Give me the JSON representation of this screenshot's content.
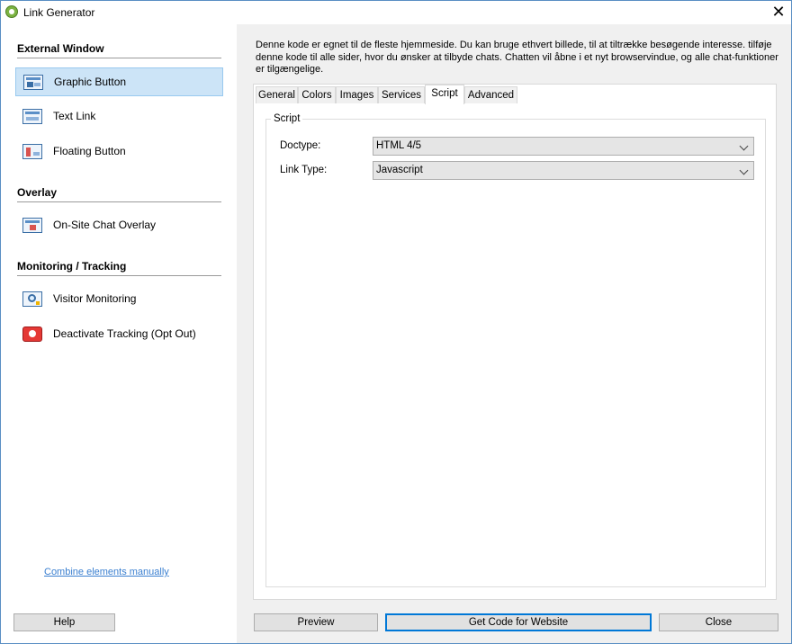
{
  "window": {
    "title": "Link Generator"
  },
  "sidebar": {
    "sections": [
      {
        "header": "External Window",
        "items": [
          {
            "label": "Graphic Button",
            "icon": "graphic-button-icon",
            "selected": true
          },
          {
            "label": "Text Link",
            "icon": "text-link-icon"
          },
          {
            "label": "Floating Button",
            "icon": "floating-button-icon"
          }
        ]
      },
      {
        "header": "Overlay",
        "items": [
          {
            "label": "On-Site Chat Overlay",
            "icon": "chat-overlay-icon"
          }
        ]
      },
      {
        "header": "Monitoring / Tracking",
        "items": [
          {
            "label": "Visitor Monitoring",
            "icon": "visitor-monitoring-icon"
          },
          {
            "label": "Deactivate Tracking (Opt Out)",
            "icon": "deactivate-tracking-icon"
          }
        ]
      }
    ],
    "combine_link": "Combine elements manually"
  },
  "main": {
    "description": "Denne kode er egnet til de fleste hjemmeside. Du kan bruge ethvert billede, til at tiltrække besøgende interesse. tilføje denne kode til alle sider, hvor du ønsker at tilbyde chats. Chatten vil åbne i et nyt browservindue, og alle chat-funktioner er tilgængelige.",
    "tabs": [
      {
        "label": "General"
      },
      {
        "label": "Colors"
      },
      {
        "label": "Images"
      },
      {
        "label": "Services"
      },
      {
        "label": "Script",
        "active": true
      },
      {
        "label": "Advanced"
      }
    ],
    "script_group": {
      "title": "Script",
      "doctype_label": "Doctype:",
      "doctype_value": "HTML 4/5",
      "linktype_label": "Link Type:",
      "linktype_value": "Javascript"
    }
  },
  "buttons": {
    "help": "Help",
    "preview": "Preview",
    "get_code": "Get Code for Website",
    "close": "Close"
  },
  "colors": {
    "selection_bg": "#cce4f7",
    "selection_border": "#99c9ef",
    "link": "#3a7fd0",
    "default_button_border": "#0078d7"
  }
}
